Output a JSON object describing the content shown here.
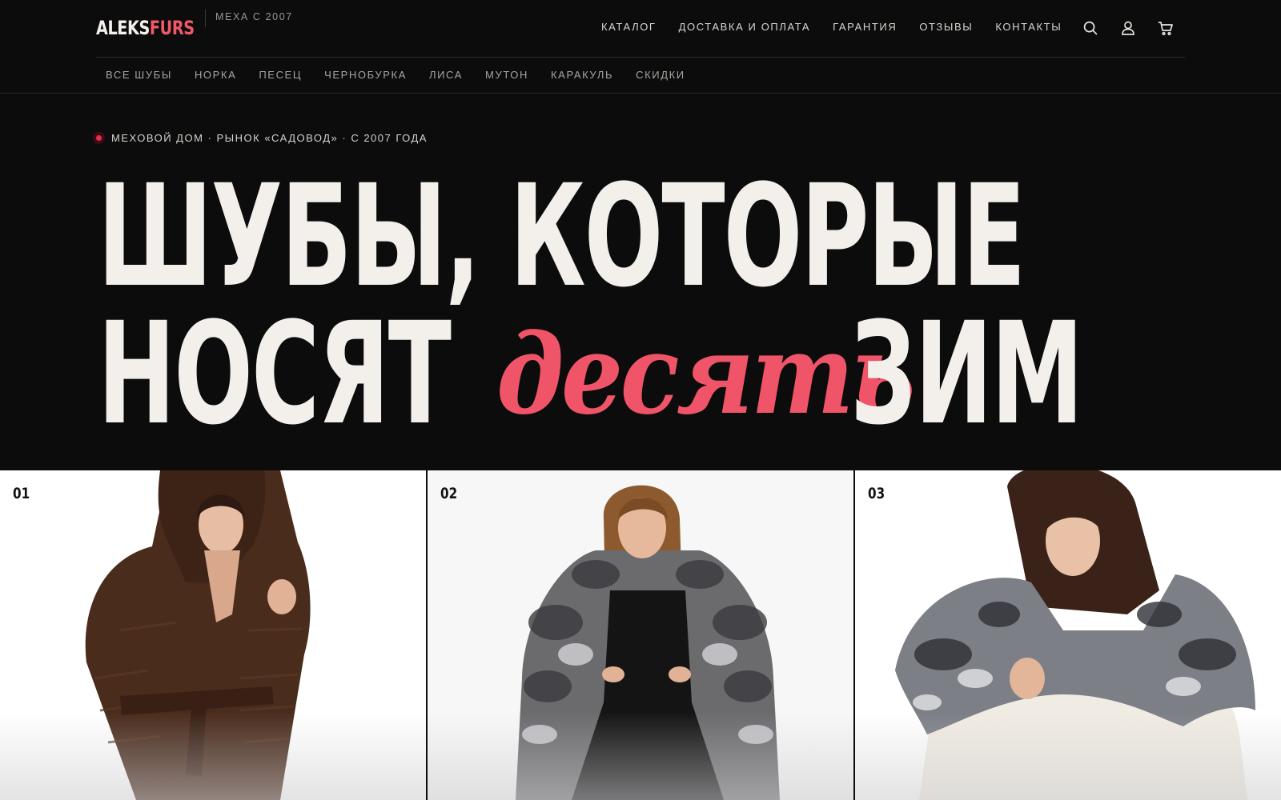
{
  "brand": {
    "logo_part1": "ALEKS",
    "logo_part2": "FURS",
    "tagline": "МЕХА С 2007",
    "accent_color": "#f2576a"
  },
  "main_nav": [
    {
      "label": "КАТАЛОГ"
    },
    {
      "label": "ДОСТАВКА И ОПЛАТА"
    },
    {
      "label": "ГАРАНТИЯ"
    },
    {
      "label": "ОТЗЫВЫ"
    },
    {
      "label": "КОНТАКТЫ"
    }
  ],
  "header_icons": [
    "search-icon",
    "user-icon",
    "cart-icon"
  ],
  "category_nav": [
    {
      "label": "ВСЕ ШУБЫ"
    },
    {
      "label": "НОРКА"
    },
    {
      "label": "ПЕСЕЦ"
    },
    {
      "label": "ЧЕРНОБУРКА"
    },
    {
      "label": "ЛИСА"
    },
    {
      "label": "МУТОН"
    },
    {
      "label": "КАРАКУЛЬ"
    },
    {
      "label": "СКИДКИ"
    }
  ],
  "hero": {
    "eyebrow": "МЕХОВОЙ ДОМ · РЫНОК «САДОВОД» · С 2007 ГОДА",
    "headline_line1": "ШУБЫ, КОТОРЫЕ",
    "headline_line2_start": "НОСЯТ",
    "headline_script": "десять",
    "headline_line2_end": "ЗИМ"
  },
  "products": [
    {
      "number": "01",
      "image": "woman in brown mink coat with hood and belt"
    },
    {
      "number": "02",
      "image": "woman in silver fox fur jacket over black dress"
    },
    {
      "number": "03",
      "image": "woman in white fur coat with silver fox collar"
    }
  ]
}
